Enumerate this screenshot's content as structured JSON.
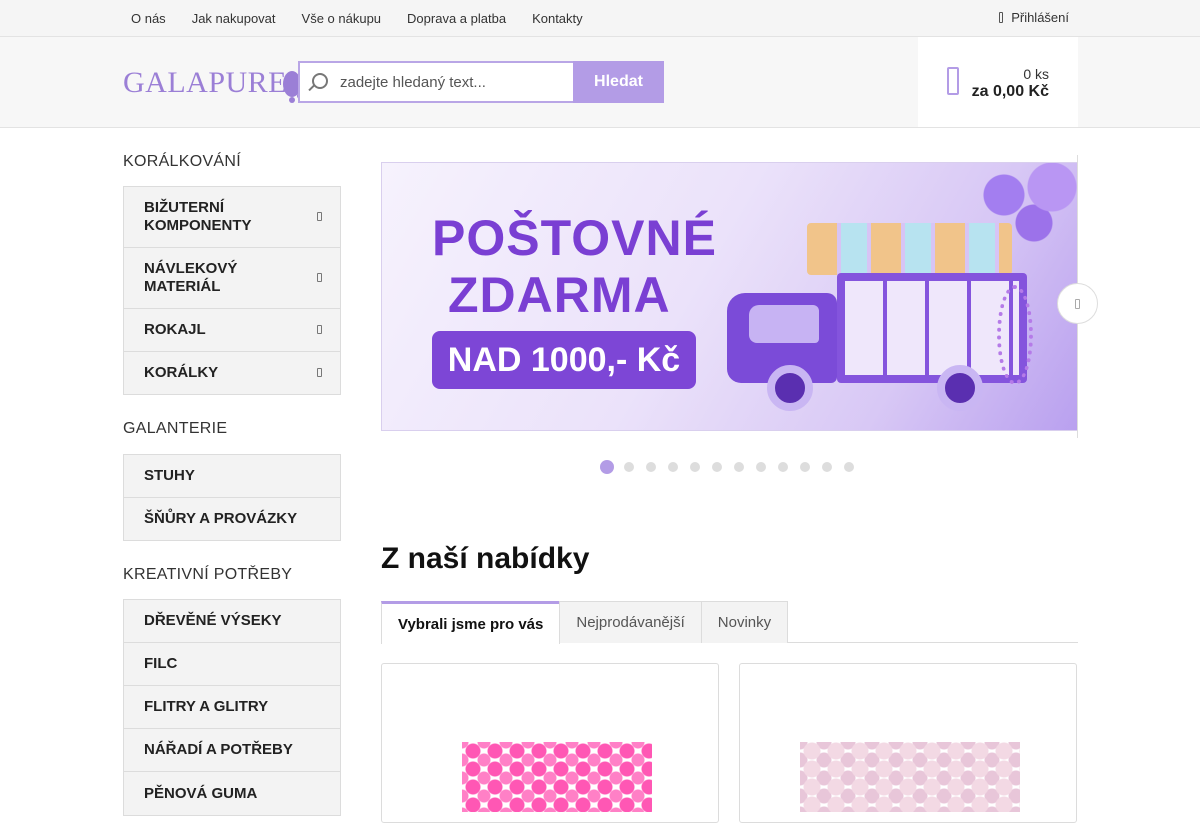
{
  "topnav": {
    "links": [
      "O nás",
      "Jak nakupovat",
      "Vše o nákupu",
      "Doprava a platba",
      "Kontakty"
    ],
    "login": "Přihlášení",
    "login_icon": "lock-icon"
  },
  "header": {
    "logo": "GALAPURE",
    "search_placeholder": "zadejte hledaný text...",
    "search_button": "Hledat",
    "cart_count": "0 ks",
    "cart_total": "za 0,00 Kč",
    "cart_icon": "shopping-bag-icon",
    "accent_color": "#b39ce6"
  },
  "sidebar": {
    "sections": [
      {
        "title": "KORÁLKOVÁNÍ",
        "items": [
          "BIŽUTERNÍ KOMPONENTY",
          "NÁVLEKOVÝ MATERIÁL",
          "ROKAJL",
          "KORÁLKY"
        ]
      },
      {
        "title": "GALANTERIE",
        "items": [
          "STUHY",
          "ŠŇŮRY A PROVÁZKY"
        ]
      },
      {
        "title": "KREATIVNÍ POTŘEBY",
        "items": [
          "DŘEVĚNÉ VÝSEKY",
          "FILC",
          "FLITRY A GLITRY",
          "NÁŘADÍ A POTŘEBY",
          "PĚNOVÁ GUMA"
        ]
      }
    ]
  },
  "banner": {
    "line1": "POŠTOVNÉ",
    "line2": "ZDARMA",
    "line3": "NAD 1000,- Kč",
    "slide_count": 12,
    "active_slide": 1
  },
  "offers": {
    "title": "Z naší nabídky",
    "tabs": [
      "Vybrali jsme pro vás",
      "Nejprodávanější",
      "Novinky"
    ],
    "active_tab": 0
  }
}
